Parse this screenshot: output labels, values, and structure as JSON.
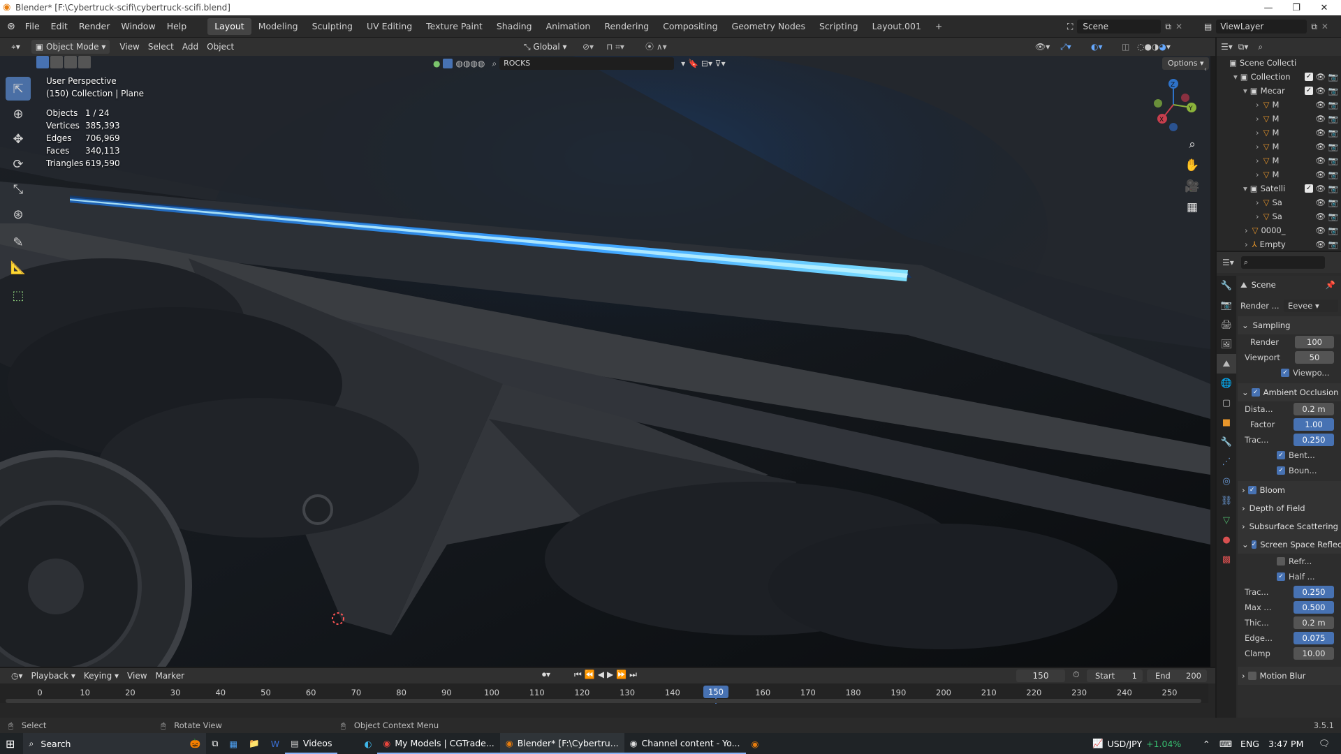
{
  "window": {
    "title": "Blender* [F:\\Cybertruck-scifi\\cybertruck-scifi.blend]"
  },
  "menu": {
    "items": [
      "File",
      "Edit",
      "Render",
      "Window",
      "Help"
    ]
  },
  "workspaces": [
    "Layout",
    "Modeling",
    "Sculpting",
    "UV Editing",
    "Texture Paint",
    "Shading",
    "Animation",
    "Rendering",
    "Compositing",
    "Geometry Nodes",
    "Scripting",
    "Layout.001"
  ],
  "scene": {
    "name": "Scene",
    "viewlayer": "ViewLayer"
  },
  "header3d": {
    "mode": "Object Mode",
    "view": "View",
    "select": "Select",
    "add": "Add",
    "object": "Object",
    "orientation": "Global",
    "search": "ROCKS",
    "options": "Options"
  },
  "viewport": {
    "perspective": "User Perspective",
    "collection": "(150) Collection | Plane",
    "stats": [
      {
        "label": "Objects",
        "value": "1 / 24"
      },
      {
        "label": "Vertices",
        "value": "385,393"
      },
      {
        "label": "Edges",
        "value": "706,969"
      },
      {
        "label": "Faces",
        "value": "340,113"
      },
      {
        "label": "Triangles",
        "value": "619,590"
      }
    ],
    "gizmo": {
      "x": "X",
      "y": "Y",
      "z": "Z"
    }
  },
  "outliner": {
    "title": "Scene Collecti",
    "rows": [
      {
        "label": "Collection",
        "icon": "collection"
      },
      {
        "label": "Mecar",
        "icon": "collection"
      },
      {
        "label": "M",
        "icon": "mesh"
      },
      {
        "label": "M",
        "icon": "mesh"
      },
      {
        "label": "M",
        "icon": "mesh"
      },
      {
        "label": "M",
        "icon": "mesh"
      },
      {
        "label": "M",
        "icon": "mesh"
      },
      {
        "label": "M",
        "icon": "mesh"
      },
      {
        "label": "Satelli",
        "icon": "collection"
      },
      {
        "label": "Sa",
        "icon": "mesh"
      },
      {
        "label": "Sa",
        "icon": "mesh"
      },
      {
        "label": "0000_",
        "icon": "mesh"
      },
      {
        "label": "Empty",
        "icon": "empty"
      }
    ]
  },
  "properties": {
    "title": "Scene",
    "render_engine_label": "Render ...",
    "render_engine": "Eevee",
    "sampling": {
      "title": "Sampling",
      "render_label": "Render",
      "render": "100",
      "viewport_label": "Viewport",
      "viewport": "50",
      "denoise": "Viewpo..."
    },
    "ao": {
      "title": "Ambient Occlusion",
      "distance_label": "Dista...",
      "distance": "0.2 m",
      "factor_label": "Factor",
      "factor": "1.00",
      "trace_label": "Trac...",
      "trace": "0.250",
      "bent": "Bent...",
      "bounce": "Boun..."
    },
    "bloom": "Bloom",
    "dof": "Depth of Field",
    "sss": "Subsurface Scattering",
    "ssr": {
      "title": "Screen Space Reflect",
      "refraction": "Refr...",
      "half": "Half ...",
      "trace_label": "Trac...",
      "trace": "0.250",
      "max_label": "Max ...",
      "max": "0.500",
      "thick_label": "Thic...",
      "thick": "0.2 m",
      "edge_label": "Edge...",
      "edge": "0.075",
      "clamp_label": "Clamp",
      "clamp": "10.00"
    },
    "motion_blur": "Motion Blur"
  },
  "timeline": {
    "menus": [
      "Playback",
      "Keying",
      "View",
      "Marker"
    ],
    "current": "150",
    "start_label": "Start",
    "start": "1",
    "end_label": "End",
    "end": "200",
    "ticks": [
      "0",
      "10",
      "20",
      "30",
      "40",
      "50",
      "60",
      "70",
      "80",
      "90",
      "100",
      "110",
      "120",
      "130",
      "140",
      "150",
      "160",
      "170",
      "180",
      "190",
      "200",
      "210",
      "220",
      "230",
      "240",
      "250"
    ]
  },
  "status": {
    "select": "Select",
    "rotate": "Rotate View",
    "context": "Object Context Menu",
    "version": "3.5.1"
  },
  "taskbar": {
    "search": "Search",
    "apps": [
      "Videos",
      "My Models | CGTrade...",
      "Blender* [F:\\Cybertru...",
      "Channel content - Yo..."
    ],
    "ticker": "USD/JPY",
    "ticker_change": "+1.04%",
    "lang": "ENG",
    "time": "3:47 PM"
  }
}
